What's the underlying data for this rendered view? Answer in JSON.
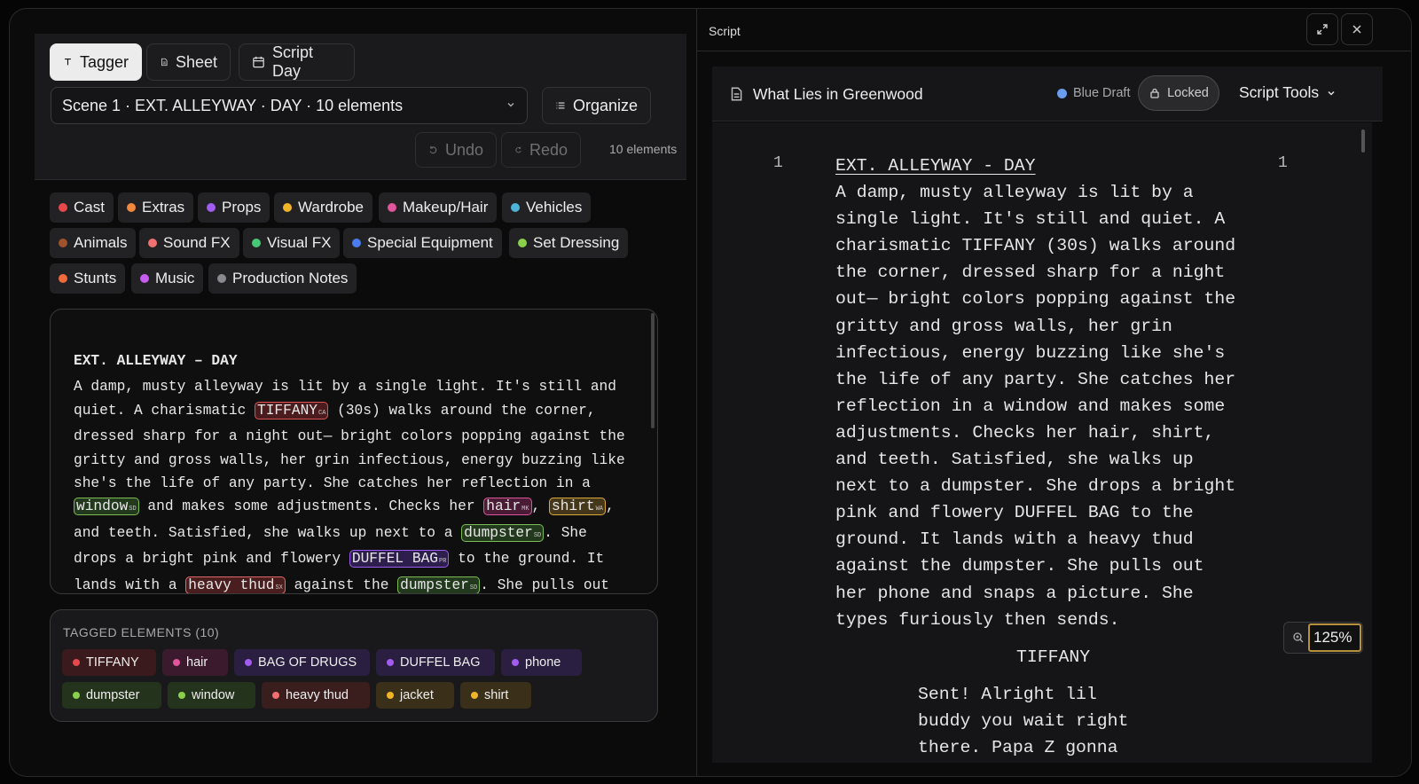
{
  "tabs": [
    {
      "label": "Tagger",
      "active": true
    },
    {
      "label": "Sheet",
      "active": false
    },
    {
      "label": "Script Day",
      "active": false
    }
  ],
  "scene_select": {
    "value": "Scene 1 · EXT. ALLEYWAY · DAY · 10 elements"
  },
  "organize_label": "Organize",
  "undo_label": "Undo",
  "redo_label": "Redo",
  "elements_count": "10 elements",
  "categories": [
    {
      "label": "Cast",
      "color": "#e5484d"
    },
    {
      "label": "Extras",
      "color": "#f0883e"
    },
    {
      "label": "Props",
      "color": "#a25cf0"
    },
    {
      "label": "Wardrobe",
      "color": "#f0b429"
    },
    {
      "label": "Makeup/Hair",
      "color": "#e0559b"
    },
    {
      "label": "Vehicles",
      "color": "#4fb3d9"
    },
    {
      "label": "Animals",
      "color": "#a0522d"
    },
    {
      "label": "Sound FX",
      "color": "#f07070"
    },
    {
      "label": "Visual FX",
      "color": "#48c774"
    },
    {
      "label": "Special Equipment",
      "color": "#4a7cf0"
    },
    {
      "label": "Set Dressing",
      "color": "#8bd04a"
    },
    {
      "label": "Stunts",
      "color": "#f06a3e"
    },
    {
      "label": "Music",
      "color": "#c75cf0"
    },
    {
      "label": "Production Notes",
      "color": "#8a8a8e"
    }
  ],
  "scene_text": {
    "heading": "EXT. ALLEYWAY – DAY",
    "p1": "A damp, musty alleyway is lit by a single light. It's still and quiet. A charismatic ",
    "tiffany": "TIFFANY",
    "tiffany_code": "CA",
    "p2": " (30s) walks around the corner, dressed sharp for a night out— bright colors popping against the gritty and gross walls, her grin infectious, energy buzzing like she's the life of any party. She catches her reflection in a ",
    "window": "window",
    "window_code": "SD",
    "p3": " and makes some adjustments. Checks her ",
    "hair": "hair",
    "hair_code": "MK",
    "p4": ", ",
    "shirt": "shirt",
    "shirt_code": "WA",
    "p5": ", and teeth. Satisfied, she walks up next to a ",
    "dumpster": "dumpster",
    "dumpster_code": "SD",
    "p6": ". She drops a bright pink and flowery ",
    "duffel": "DUFFEL BAG",
    "duffel_code": "PR",
    "p7": " to the ground. It lands with a ",
    "thud": "heavy thud",
    "thud_code": "SX",
    "p8": " against the ",
    "dumpster2": "dumpster",
    "dumpster2_code": "SD",
    "p9": ". She pulls out"
  },
  "tagged": {
    "title": "TAGGED ELEMENTS (10)",
    "items": [
      {
        "label": "TIFFANY",
        "color": "#e5484d",
        "bg": "#3a1a1c"
      },
      {
        "label": "hair",
        "color": "#e0559b",
        "bg": "#3a1a2c"
      },
      {
        "label": "BAG OF DRUGS",
        "color": "#a25cf0",
        "bg": "#2a1f40"
      },
      {
        "label": "DUFFEL BAG",
        "color": "#a25cf0",
        "bg": "#2a1f40"
      },
      {
        "label": "phone",
        "color": "#a25cf0",
        "bg": "#2a1f40"
      },
      {
        "label": "dumpster",
        "color": "#8bd04a",
        "bg": "#24331c"
      },
      {
        "label": "window",
        "color": "#8bd04a",
        "bg": "#24331c"
      },
      {
        "label": "heavy thud",
        "color": "#f07070",
        "bg": "#3a1e1e"
      },
      {
        "label": "jacket",
        "color": "#f0b429",
        "bg": "#3a2f18"
      },
      {
        "label": "shirt",
        "color": "#f0b429",
        "bg": "#3a2f18"
      }
    ]
  },
  "right": {
    "panel_title": "Script",
    "doc_name": "What Lies in Greenwood",
    "draft_label": "Blue Draft",
    "draft_color": "#6a9cf0",
    "locked_label": "Locked",
    "tools_label": "Script Tools",
    "scene_number": "1",
    "scene_heading": "EXT. ALLEYWAY - DAY",
    "action": "A damp, musty alleyway is lit by a\nsingle light. It's still and quiet. A\ncharismatic TIFFANY (30s) walks around\nthe corner, dressed sharp for a night\nout— bright colors popping against the\ngritty and gross walls, her grin\ninfectious, energy buzzing like she's\nthe life of any party. She catches her\nreflection in a window and makes some\nadjustments. Checks her hair, shirt,\nand teeth. Satisfied, she walks up\nnext to a dumpster. She drops a bright\npink and flowery DUFFEL BAG to the\nground. It lands with a heavy thud\nagainst the dumpster. She pulls out\nher phone and snaps a picture. She\ntypes furiously then sends.",
    "character": "TIFFANY",
    "dialogue": "Sent! Alright lil\nbuddy you wait right\nthere. Papa Z gonna",
    "zoom": "125%"
  }
}
